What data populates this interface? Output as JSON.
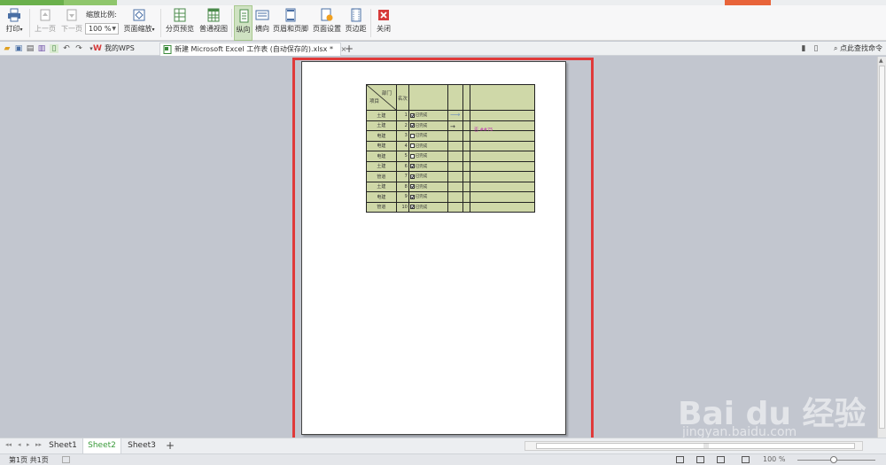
{
  "ribbon": {
    "print": "打印",
    "prev_page": "上一页",
    "next_page": "下一页",
    "zoom_ratio_label": "缩放比例:",
    "zoom_value": "100 %",
    "page_zoom": "页面缩放",
    "page_break_preview": "分页预览",
    "normal_view": "普通视图",
    "portrait": "纵向",
    "landscape": "横向",
    "header_footer": "页眉和页脚",
    "page_setup": "页面设置",
    "margins": "页边距",
    "close": "关闭"
  },
  "doc_tabs": [
    {
      "label": "我的WPS"
    },
    {
      "label": "新建 Microsoft Excel 工作表 (自动保存的).xlsx *",
      "close": "×"
    }
  ],
  "search_command": "点此查找命令",
  "table": {
    "header_dept": "部门",
    "header_project": "项目",
    "header_name": "名次",
    "rows": [
      {
        "dept": "土建",
        "num": "1",
        "checked": true,
        "label": "已完成"
      },
      {
        "dept": "土建",
        "num": "2",
        "checked": true,
        "label": "已完成"
      },
      {
        "dept": "电建",
        "num": "3",
        "checked": false,
        "label": "已完成"
      },
      {
        "dept": "电建",
        "num": "4",
        "checked": false,
        "label": "已完成"
      },
      {
        "dept": "电建",
        "num": "5",
        "checked": false,
        "label": "已完成"
      },
      {
        "dept": "土建",
        "num": "6",
        "checked": true,
        "label": "已完成"
      },
      {
        "dept": "管道",
        "num": "7",
        "checked": true,
        "label": "已完成"
      },
      {
        "dept": "土建",
        "num": "8",
        "checked": true,
        "label": "已完成"
      },
      {
        "dept": "电建",
        "num": "9",
        "checked": true,
        "label": "已完成"
      },
      {
        "dept": "管道",
        "num": "10",
        "checked": true,
        "label": "已完成"
      }
    ],
    "note": "否 ##75",
    "arrow1": "⟶",
    "arrow2": "→"
  },
  "sheet_tabs": [
    "Sheet1",
    "Sheet2",
    "Sheet3"
  ],
  "active_sheet": "Sheet2",
  "add_sheet": "+",
  "status": {
    "page_info": "第1页 共1页",
    "zoom_percent": "100 %"
  },
  "watermark": {
    "brand": "Bai du 经验",
    "url": "jingyan.baidu.com"
  },
  "colors": {
    "frame": "#e03a3a",
    "table_bg": "#cfd8a8",
    "active_tab": "#3a9a3a",
    "portrait_active": "#cfe2c2"
  }
}
